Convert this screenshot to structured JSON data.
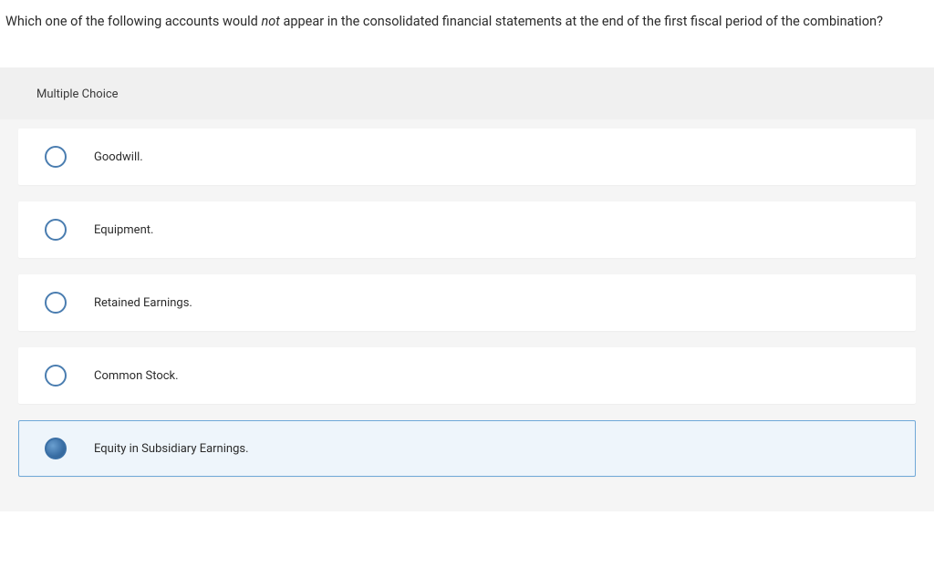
{
  "question": {
    "prefix": "Which one of the following accounts would ",
    "emph": "not",
    "suffix": " appear in the consolidated financial statements at the end of the first fiscal period of the combination?"
  },
  "section_label": "Multiple Choice",
  "options": [
    {
      "label": "Goodwill.",
      "selected": false
    },
    {
      "label": "Equipment.",
      "selected": false
    },
    {
      "label": "Retained Earnings.",
      "selected": false
    },
    {
      "label": "Common Stock.",
      "selected": false
    },
    {
      "label": "Equity in Subsidiary Earnings.",
      "selected": true
    }
  ]
}
